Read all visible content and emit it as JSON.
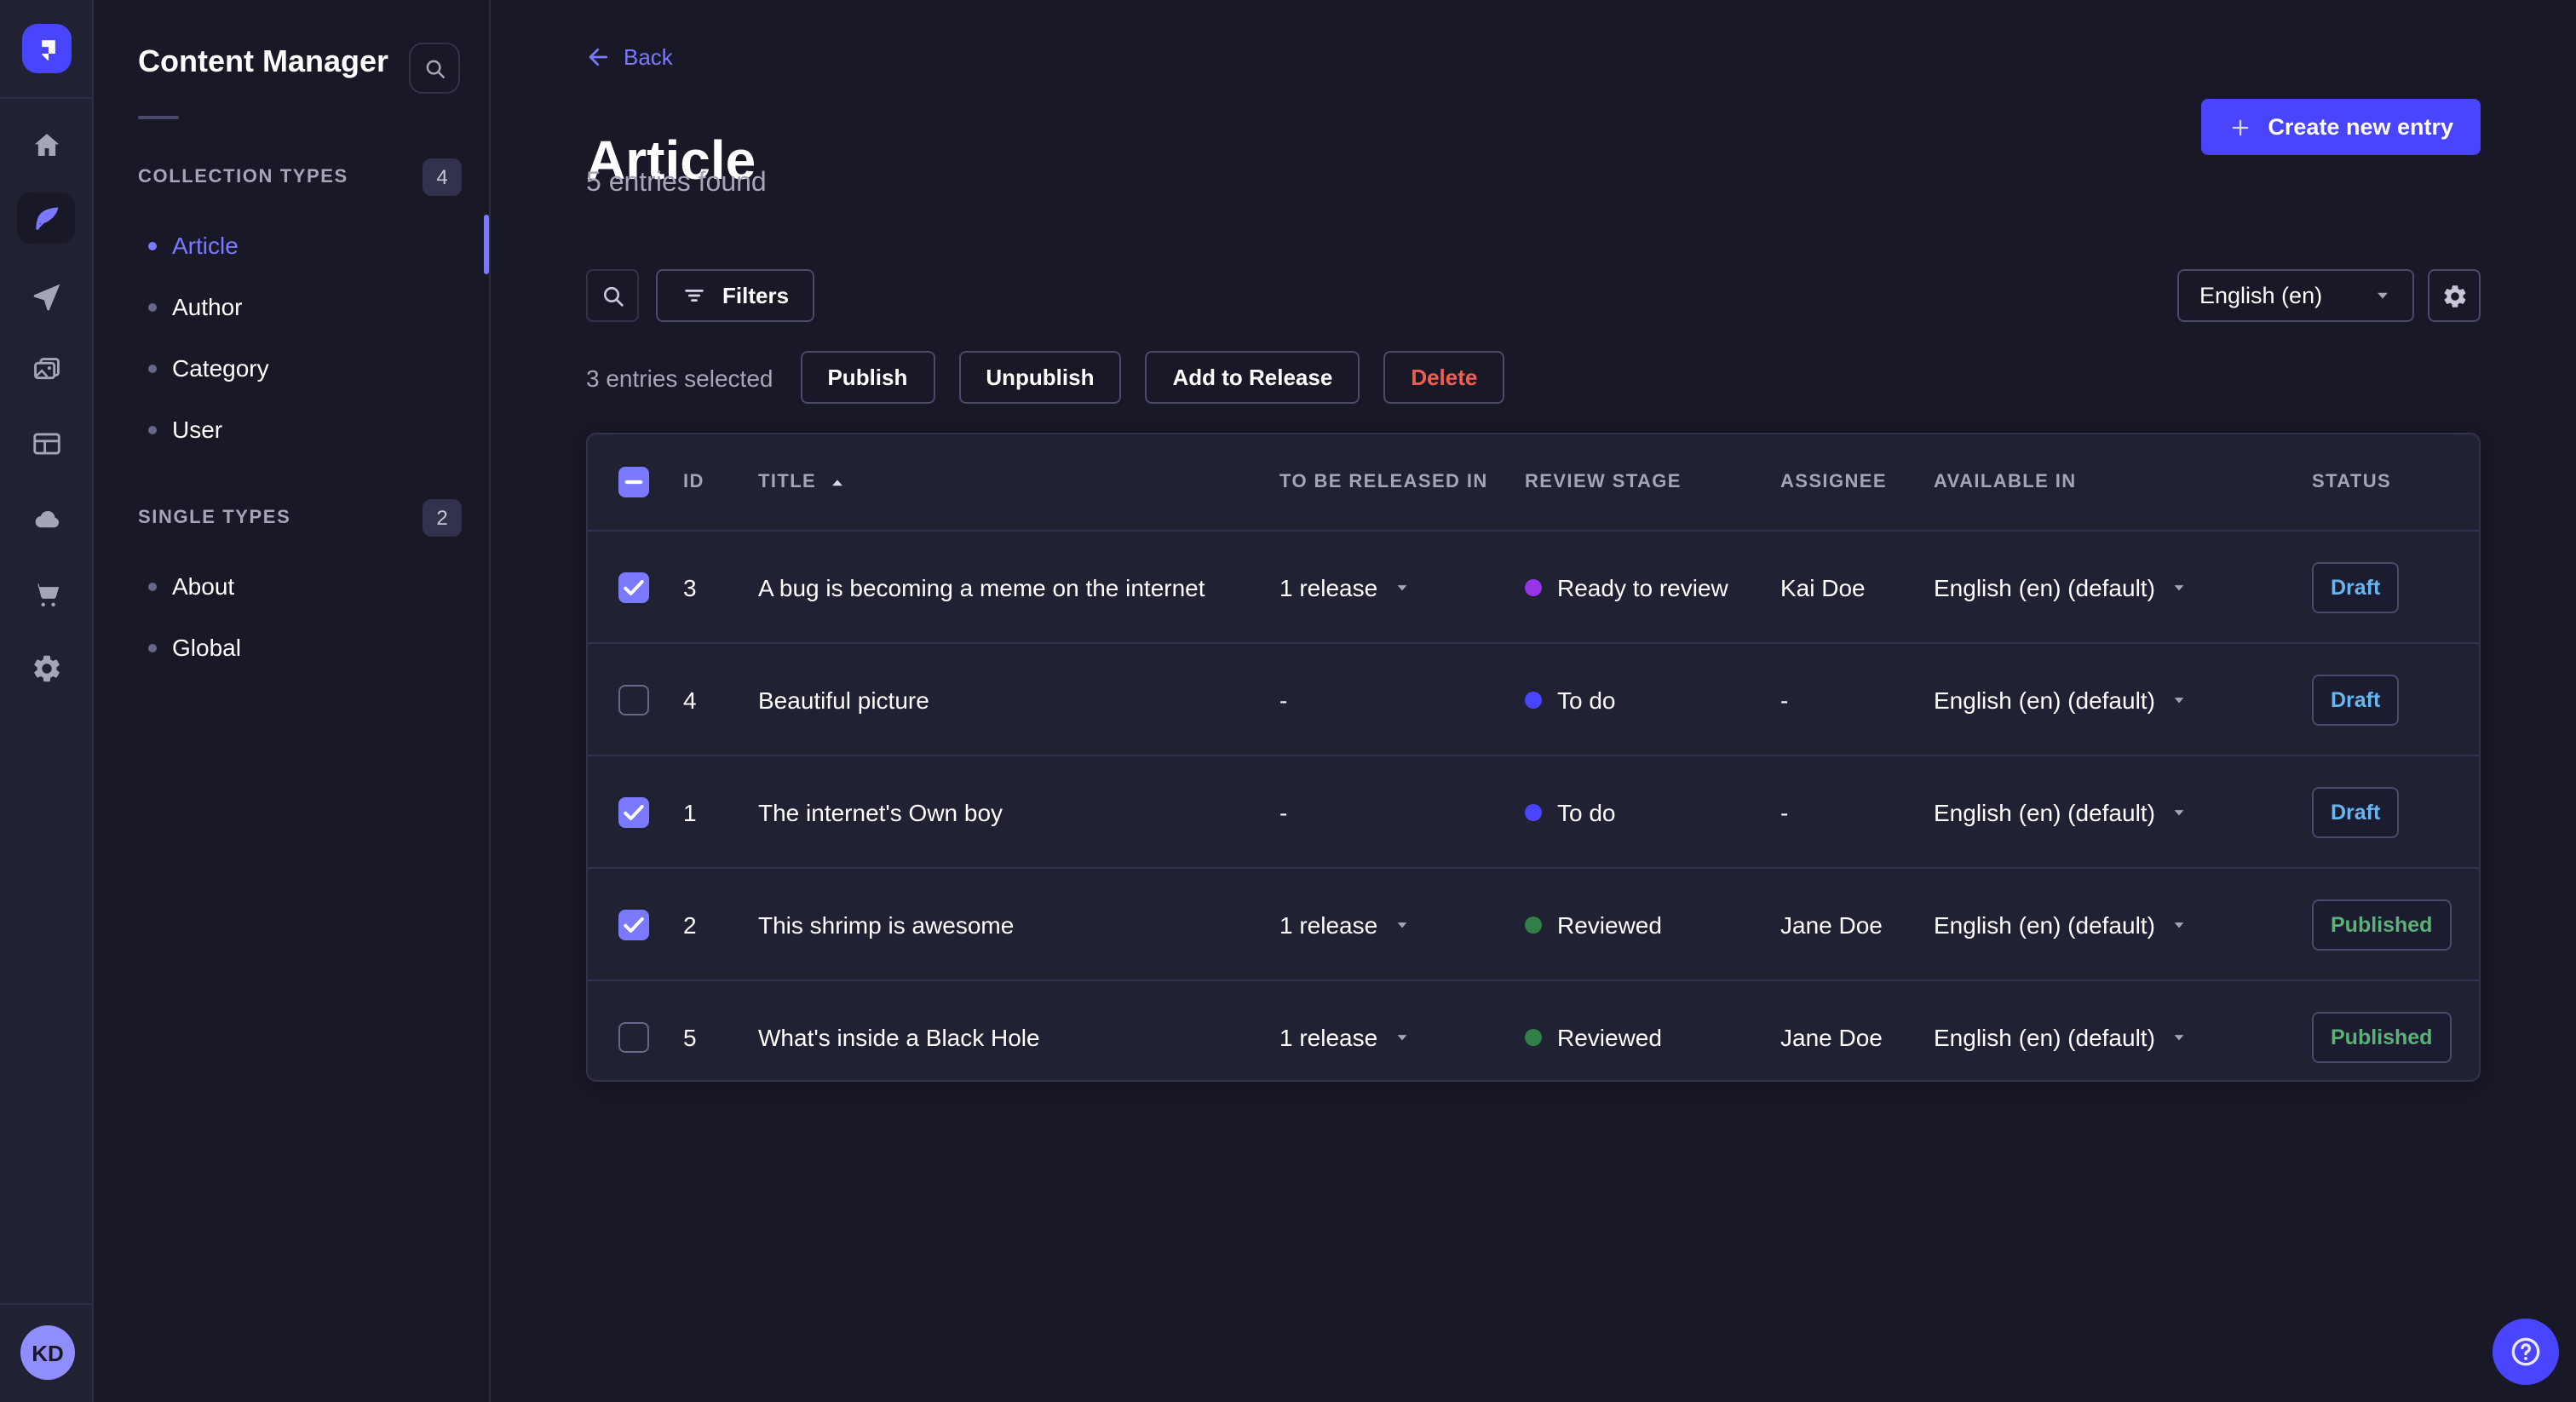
{
  "rail": {
    "items": [
      {
        "icon": "home-icon",
        "active": false
      },
      {
        "icon": "content-manager-icon",
        "active": true
      },
      {
        "icon": "releases-icon",
        "active": false
      },
      {
        "icon": "media-library-icon",
        "active": false
      },
      {
        "icon": "content-type-builder-icon",
        "active": false
      },
      {
        "icon": "deploy-icon",
        "active": false
      },
      {
        "icon": "marketplace-icon",
        "active": false
      },
      {
        "icon": "settings-icon",
        "active": false
      }
    ],
    "avatar_initials": "KD"
  },
  "sidebar": {
    "title": "Content Manager",
    "sections": [
      {
        "label": "COLLECTION TYPES",
        "count": "4",
        "items": [
          {
            "label": "Article",
            "active": true
          },
          {
            "label": "Author",
            "active": false
          },
          {
            "label": "Category",
            "active": false
          },
          {
            "label": "User",
            "active": false
          }
        ]
      },
      {
        "label": "SINGLE TYPES",
        "count": "2",
        "items": [
          {
            "label": "About",
            "active": false
          },
          {
            "label": "Global",
            "active": false
          }
        ]
      }
    ]
  },
  "header": {
    "back_label": "Back",
    "title": "Article",
    "subtitle": "5 entries found",
    "create_label": "Create new entry"
  },
  "toolbar": {
    "filters_label": "Filters",
    "locale_value": "English (en)"
  },
  "selection": {
    "text": "3 entries selected",
    "publish_label": "Publish",
    "unpublish_label": "Unpublish",
    "add_to_release_label": "Add to Release",
    "delete_label": "Delete"
  },
  "table": {
    "header_checkbox": "indeterminate",
    "columns": [
      {
        "label": "ID"
      },
      {
        "label": "TITLE",
        "sort": "asc"
      },
      {
        "label": "TO BE RELEASED IN"
      },
      {
        "label": "REVIEW STAGE"
      },
      {
        "label": "ASSIGNEE"
      },
      {
        "label": "AVAILABLE IN"
      },
      {
        "label": "STATUS"
      }
    ],
    "rows": [
      {
        "checked": true,
        "id": "3",
        "title": "A bug is becoming a meme on the internet",
        "release": "1 release",
        "review_stage": "Ready to review",
        "assignee": "Kai Doe",
        "available_in": "English (en) (default)",
        "status": "Draft"
      },
      {
        "checked": false,
        "id": "4",
        "title": "Beautiful picture",
        "release": "-",
        "review_stage": "To do",
        "assignee": "-",
        "available_in": "English (en) (default)",
        "status": "Draft"
      },
      {
        "checked": true,
        "id": "1",
        "title": "The internet's Own boy",
        "release": "-",
        "review_stage": "To do",
        "assignee": "-",
        "available_in": "English (en) (default)",
        "status": "Draft"
      },
      {
        "checked": true,
        "id": "2",
        "title": "This shrimp is awesome",
        "release": "1 release",
        "review_stage": "Reviewed",
        "assignee": "Jane Doe",
        "available_in": "English (en) (default)",
        "status": "Published"
      },
      {
        "checked": false,
        "id": "5",
        "title": "What's inside a Black Hole",
        "release": "1 release",
        "review_stage": "Reviewed",
        "assignee": "Jane Doe",
        "available_in": "English (en) (default)",
        "status": "Published"
      }
    ]
  },
  "colors": {
    "primary": "#4945ff",
    "primary_light": "#7b79ff",
    "danger": "#ee5e52",
    "status": {
      "Draft": "#66b7f1",
      "Published": "#5cb176"
    },
    "stages": {
      "To do": "#4945ff",
      "Ready to review": "#9736e8",
      "Reviewed": "#328048"
    }
  }
}
